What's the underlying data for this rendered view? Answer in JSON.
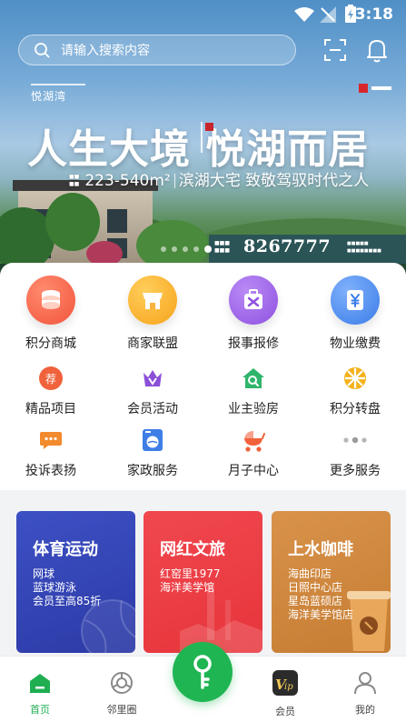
{
  "status_bar": {
    "time": "3:18"
  },
  "search": {
    "placeholder": "请输入搜索内容"
  },
  "banner": {
    "brand": "悦湖湾",
    "slogan": "人生大境 悦湖而居",
    "area": "223-540m²",
    "tagline": "滨湖大宅  致敬驾驭时代之人",
    "phone": "8267777",
    "slides": 5,
    "active_slide": 4
  },
  "services": [
    {
      "label": "积分商城",
      "icon": "coins-icon",
      "color": "#f2553d"
    },
    {
      "label": "商家联盟",
      "icon": "shop-icon",
      "color": "#f7a31c"
    },
    {
      "label": "报事报修",
      "icon": "repair-tools-icon",
      "color": "#8f52e0"
    },
    {
      "label": "物业缴费",
      "icon": "yuan-payment-icon",
      "color": "#3b7de8"
    },
    {
      "label": "精品项目",
      "icon": "recommend-badge-icon",
      "color": "#f0623b"
    },
    {
      "label": "会员活动",
      "icon": "crown-icon",
      "color": "#8b4fd8"
    },
    {
      "label": "业主验房",
      "icon": "house-inspect-icon",
      "color": "#2fb56c"
    },
    {
      "label": "积分转盘",
      "icon": "wheel-icon",
      "color": "#f5b21c"
    },
    {
      "label": "投诉表扬",
      "icon": "chat-bubble-icon",
      "color": "#f28a2e"
    },
    {
      "label": "家政服务",
      "icon": "washer-icon",
      "color": "#3e7ee6"
    },
    {
      "label": "月子中心",
      "icon": "stroller-icon",
      "color": "#f0623b"
    },
    {
      "label": "更多服务",
      "icon": "more-dots-icon",
      "color": "#b5b5b5"
    }
  ],
  "promos": [
    {
      "title": "体育运动",
      "lines": [
        "网球",
        "蓝球游泳",
        "会员至高85折"
      ],
      "color": "#3344b8"
    },
    {
      "title": "网红文旅",
      "lines": [
        "红窑里1977",
        "海洋美学馆"
      ],
      "color": "#ee4048"
    },
    {
      "title": "上水咖啡",
      "lines": [
        "海曲印店",
        "日照中心店",
        "星岛蓝硕店",
        "海洋美学馆店"
      ],
      "color": "#d08a42"
    }
  ],
  "tabs": [
    {
      "label": "首页",
      "icon": "home-icon",
      "active": true
    },
    {
      "label": "邻里圈",
      "icon": "circle-icon",
      "active": false
    },
    {
      "label": "",
      "icon": "key-icon",
      "active": false
    },
    {
      "label": "会员",
      "icon": "vip-icon",
      "active": false
    },
    {
      "label": "我的",
      "icon": "profile-icon",
      "active": false
    }
  ],
  "accent_color": "#1fb553"
}
